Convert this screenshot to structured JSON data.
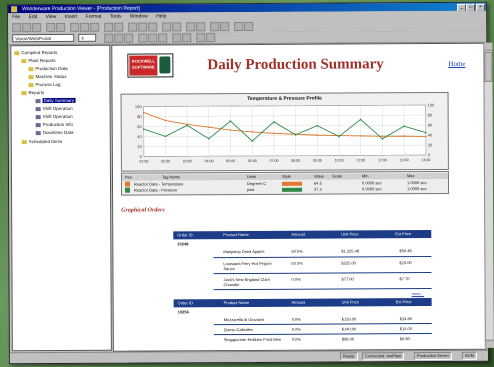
{
  "window": {
    "title": "Wonderware Production Viewer - [Production Report]",
    "controls": [
      "_",
      "□",
      "×"
    ]
  },
  "menu": [
    "File",
    "Edit",
    "View",
    "Insert",
    "Format",
    "Tools",
    "Window",
    "Help"
  ],
  "toolbar": {
    "combo_value": "Vision/Web/Portal",
    "combo2_value": "4"
  },
  "tree": {
    "items": [
      {
        "label": "Compiled Reports",
        "level": 0
      },
      {
        "label": "Plant Reports",
        "level": 1
      },
      {
        "label": "Production Data",
        "level": 2
      },
      {
        "label": "Machine Status",
        "level": 2
      },
      {
        "label": "Process Log",
        "level": 2
      },
      {
        "label": "Reports",
        "level": 1
      },
      {
        "label": "Daily Summary",
        "level": 2,
        "selected": true
      },
      {
        "label": "Shift Operation",
        "level": 3
      },
      {
        "label": "Shift Operation",
        "level": 3
      },
      {
        "label": "Production Info",
        "level": 3
      },
      {
        "label": "Downtime Data",
        "level": 3
      },
      {
        "label": "Scheduled Items",
        "level": 1
      }
    ]
  },
  "report": {
    "logo_text": "ROCKWELL SOFTWARE",
    "title": "Daily Production Summary",
    "home_link": "Home",
    "section_title": "Graphical Orders"
  },
  "chart_data": {
    "type": "line",
    "title": "Temperature & Pressure Profile",
    "x": [
      "01:00",
      "02:00",
      "03:00",
      "04:00",
      "05:00",
      "06:00",
      "07:00",
      "08:00",
      "09:00",
      "10:00",
      "11:00",
      "12:00",
      "13:00",
      "14:00"
    ],
    "y_left_ticks": [
      "100",
      "80",
      "60",
      "40",
      "20",
      "0"
    ],
    "y_right_ticks": [
      "100",
      "80",
      "60",
      "40",
      "20",
      "0"
    ],
    "ylim": [
      0,
      100
    ],
    "series": [
      {
        "color": "#e07830",
        "values": [
          88,
          72,
          64,
          58,
          52,
          48,
          45,
          43,
          41,
          40,
          39,
          38,
          38,
          37
        ]
      },
      {
        "color": "#2f8a4a",
        "values": [
          55,
          40,
          62,
          35,
          70,
          30,
          68,
          42,
          60,
          38,
          72,
          33,
          58,
          45
        ]
      }
    ],
    "legend": {
      "headers": [
        "Pen",
        "Tag Name",
        "Units",
        "Style",
        "Value",
        "Scale",
        "Min",
        "Max"
      ],
      "rows": [
        {
          "tag": "Reactor Data - Temperature",
          "units": "Degrees C",
          "value": "64.5",
          "min": "0.0000 sec",
          "max": "1.0000 sec",
          "color": "#e07830"
        },
        {
          "tag": "Reactor Data - Pressure",
          "units": "psia",
          "value": "37.2",
          "min": "0.0000 sec",
          "max": "1.0000 sec",
          "color": "#2f8a4a"
        }
      ]
    }
  },
  "orders": [
    {
      "headers": [
        "Order ID",
        "Product Name",
        "Amount",
        "Unit Price",
        "Ext Price"
      ],
      "order_id": "10248",
      "rows": [
        {
          "product": "Manjimup Dried Apples",
          "amount": "50.0%",
          "unit": "$1,325.48",
          "ext": "$56.48"
        },
        {
          "product": "Louisiana Fiery Hot Pepper Sauce",
          "amount": "50.0%",
          "unit": "$225.00",
          "ext": "$20.00"
        },
        {
          "product": "Jack's New England Clam Chowder",
          "amount": "0.0%",
          "unit": "$77.00",
          "ext": "$7.70"
        }
      ],
      "more": "more..."
    },
    {
      "headers": [
        "Order ID",
        "Product Name",
        "Amount",
        "Unit Price",
        "Ext Price"
      ],
      "order_id": "10256",
      "rows": [
        {
          "product": "Mozzarella di Giovanni",
          "amount": "0.0%",
          "unit": "$139.00",
          "ext": "$34.80"
        },
        {
          "product": "Queso Cabrales",
          "amount": "0.0%",
          "unit": "$140.00",
          "ext": "$14.00"
        },
        {
          "product": "Singaporean Hokkien Fried Mee",
          "amount": "0.0%",
          "unit": "$98.00",
          "ext": "$9.80"
        }
      ],
      "more": "more..."
    }
  ],
  "status": {
    "panels": [
      "Ready",
      "Connected: wwPlant",
      "Production Server",
      "NUM"
    ]
  }
}
